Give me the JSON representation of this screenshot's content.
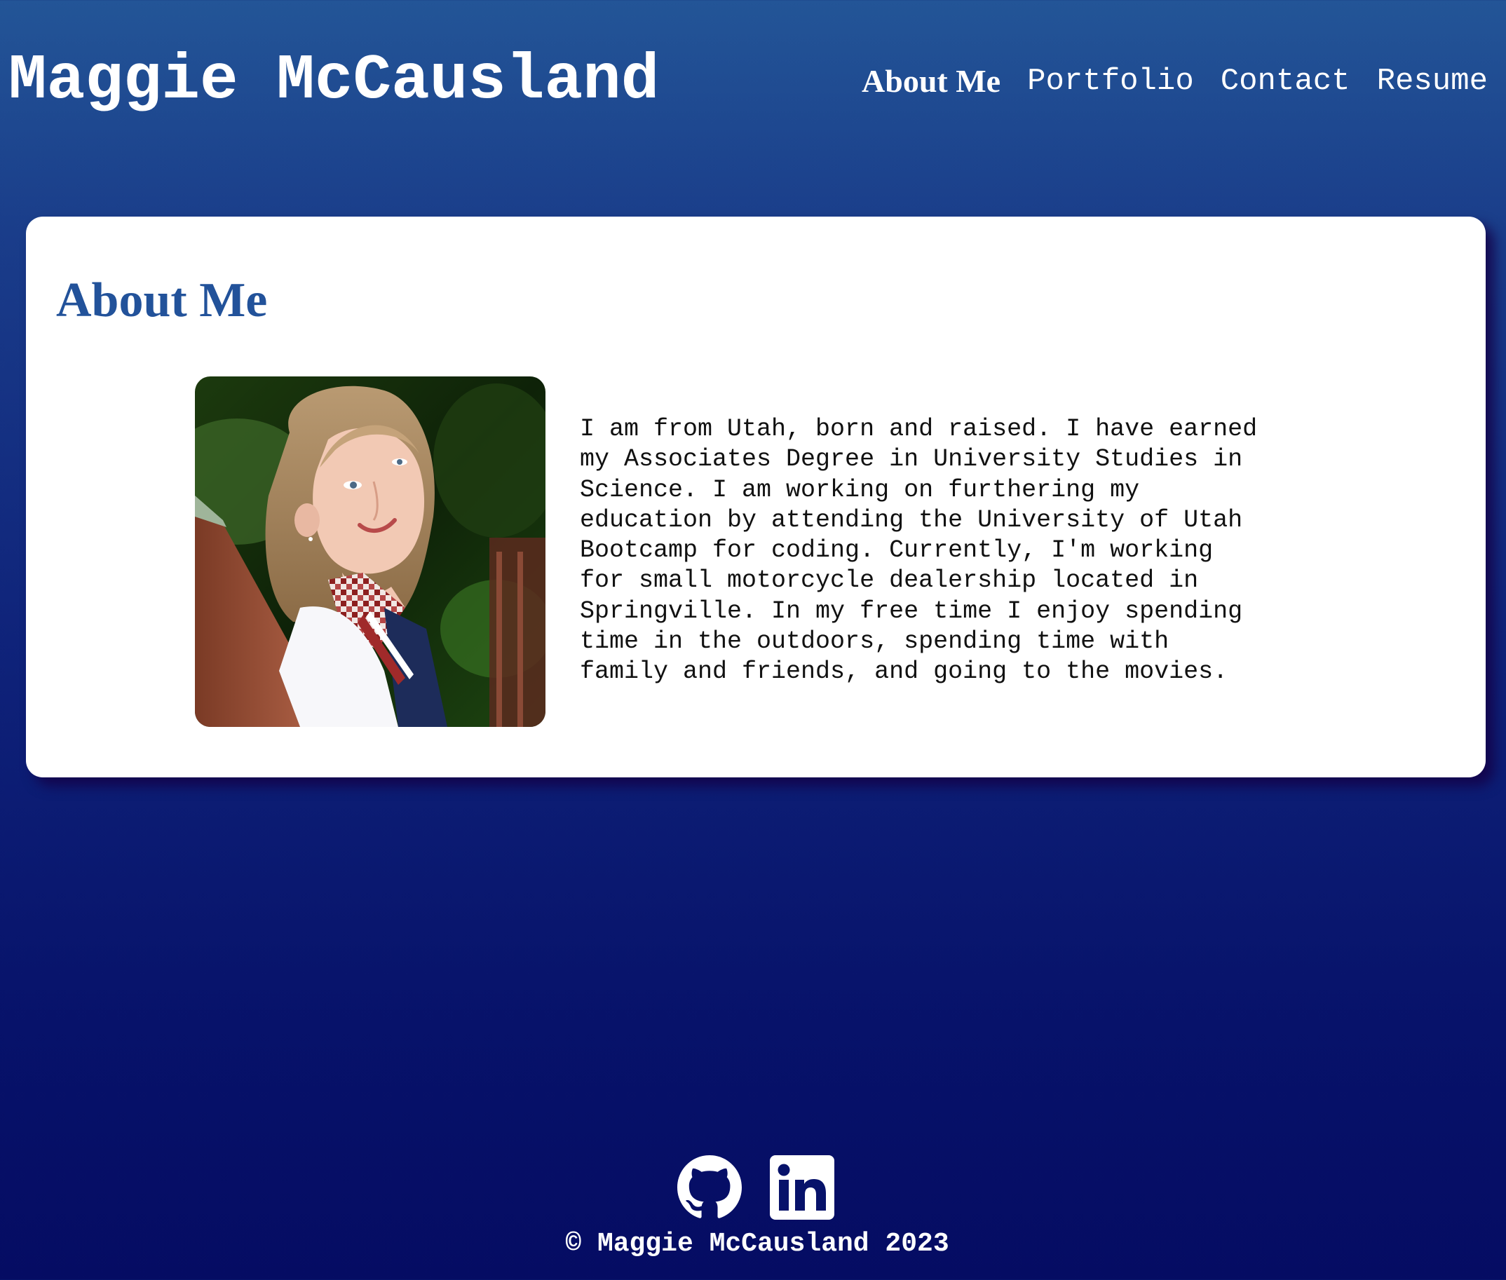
{
  "header": {
    "site_title": "Maggie McCausland",
    "nav": [
      {
        "label": "About Me",
        "active": true
      },
      {
        "label": "Portfolio",
        "active": false
      },
      {
        "label": "Contact",
        "active": false
      },
      {
        "label": "Resume",
        "active": false
      }
    ]
  },
  "about": {
    "title": "About Me",
    "bio_lines": [
      "I am from Utah, born and raised. I have earned",
      "my Associates Degree in University Studies in",
      "Science. I am working on furthering my",
      "education by attending the University of Utah",
      "Bootcamp for coding. Currently, I'm working",
      "for small motorcycle dealership located in",
      "Springville. In my free time I enjoy spending",
      "time in the outdoors, spending time with",
      "family and friends, and going to the movies."
    ],
    "photo_icon": "profile-photo"
  },
  "footer": {
    "icons": [
      "github-icon",
      "linkedin-icon"
    ],
    "copyright": "© Maggie McCausland 2023"
  },
  "colors": {
    "background_top": "#235597",
    "background_bottom": "#050c63",
    "heading_blue": "#22529a",
    "card_bg": "#ffffff",
    "card_shadow": "#140046"
  }
}
